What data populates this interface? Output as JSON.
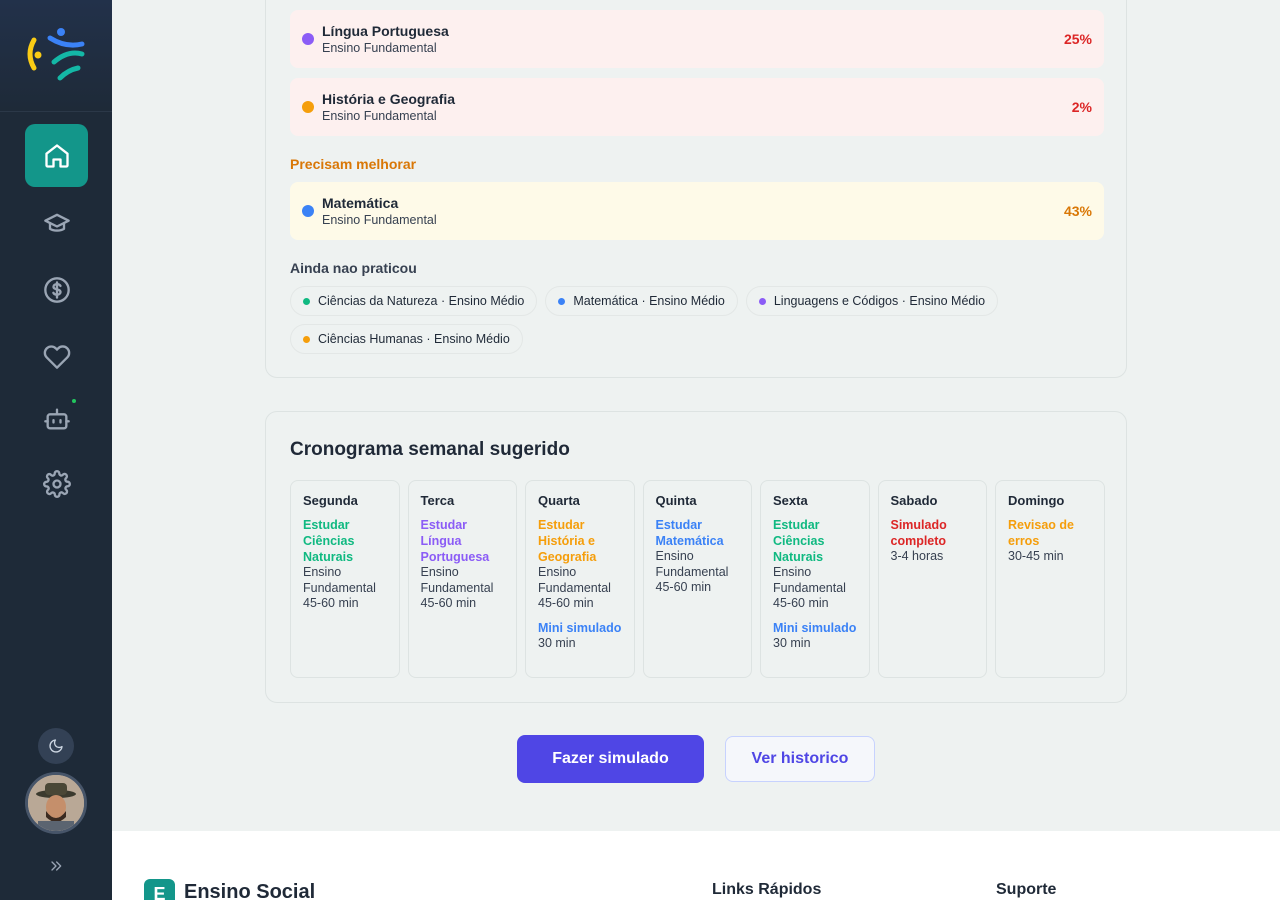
{
  "sidebar": {
    "nav": [
      {
        "icon": "home-icon",
        "active": true
      },
      {
        "icon": "graduation-cap-icon"
      },
      {
        "icon": "dollar-icon"
      },
      {
        "icon": "heart-icon"
      },
      {
        "icon": "bot-icon"
      },
      {
        "icon": "gear-icon"
      }
    ],
    "accent": "#13968a"
  },
  "performance": {
    "critical": [
      {
        "name": "Língua Portuguesa",
        "level": "Ensino Fundamental",
        "pct": "25%",
        "dot": "#8b5cf6"
      },
      {
        "name": "História e Geografia",
        "level": "Ensino Fundamental",
        "pct": "2%",
        "dot": "#f59e0b"
      }
    ],
    "improve_label": "Precisam melhorar",
    "improve": [
      {
        "name": "Matemática",
        "level": "Ensino Fundamental",
        "pct": "43%",
        "dot": "#3b82f6"
      }
    ],
    "not_practiced_label": "Ainda nao praticou",
    "not_practiced": [
      {
        "name": "Ciências da Natureza",
        "level": "Ensino Médio",
        "dot": "#10b981"
      },
      {
        "name": "Matemática",
        "level": "Ensino Médio",
        "dot": "#3b82f6"
      },
      {
        "name": "Linguagens e Códigos",
        "level": "Ensino Médio",
        "dot": "#8b5cf6"
      },
      {
        "name": "Ciências Humanas",
        "level": "Ensino Médio",
        "dot": "#f59e0b"
      }
    ]
  },
  "schedule": {
    "title": "Cronograma semanal sugerido",
    "days": [
      {
        "name": "Segunda",
        "tasks": [
          {
            "title": "Estudar Ciências Naturais",
            "color": "#10b981",
            "meta": [
              "Ensino",
              "Fundamental",
              "45-60 min"
            ]
          }
        ]
      },
      {
        "name": "Terca",
        "tasks": [
          {
            "title": "Estudar Língua Portuguesa",
            "color": "#8b5cf6",
            "meta": [
              "Ensino",
              "Fundamental",
              "45-60 min"
            ]
          }
        ]
      },
      {
        "name": "Quarta",
        "tasks": [
          {
            "title": "Estudar História e Geografia",
            "color": "#f59e0b",
            "meta": [
              "Ensino",
              "Fundamental",
              "45-60 min"
            ]
          },
          {
            "title": "Mini simulado",
            "color": "#3b82f6",
            "meta": [
              "30 min"
            ]
          }
        ]
      },
      {
        "name": "Quinta",
        "tasks": [
          {
            "title": "Estudar Matemática",
            "color": "#3b82f6",
            "meta": [
              "Ensino",
              "Fundamental",
              "45-60 min"
            ]
          }
        ]
      },
      {
        "name": "Sexta",
        "tasks": [
          {
            "title": "Estudar Ciências Naturais",
            "color": "#10b981",
            "meta": [
              "Ensino",
              "Fundamental",
              "45-60 min"
            ]
          },
          {
            "title": "Mini simulado",
            "color": "#3b82f6",
            "meta": [
              "30 min"
            ]
          }
        ]
      },
      {
        "name": "Sabado",
        "tasks": [
          {
            "title": "Simulado completo",
            "color": "#dc2626",
            "meta": [
              "3-4 horas"
            ]
          }
        ]
      },
      {
        "name": "Domingo",
        "tasks": [
          {
            "title": "Revisao de erros",
            "color": "#f59e0b",
            "meta": [
              "30-45 min"
            ]
          }
        ]
      }
    ]
  },
  "actions": {
    "primary": "Fazer simulado",
    "secondary": "Ver historico"
  },
  "footer": {
    "logo_letter": "E",
    "brand": "Ensino Social",
    "col1": "Links Rápidos",
    "col2": "Suporte"
  },
  "colors": {
    "critical_pct": "#dc2626",
    "improve_pct": "#d97706",
    "improve_label": "#d97706"
  }
}
